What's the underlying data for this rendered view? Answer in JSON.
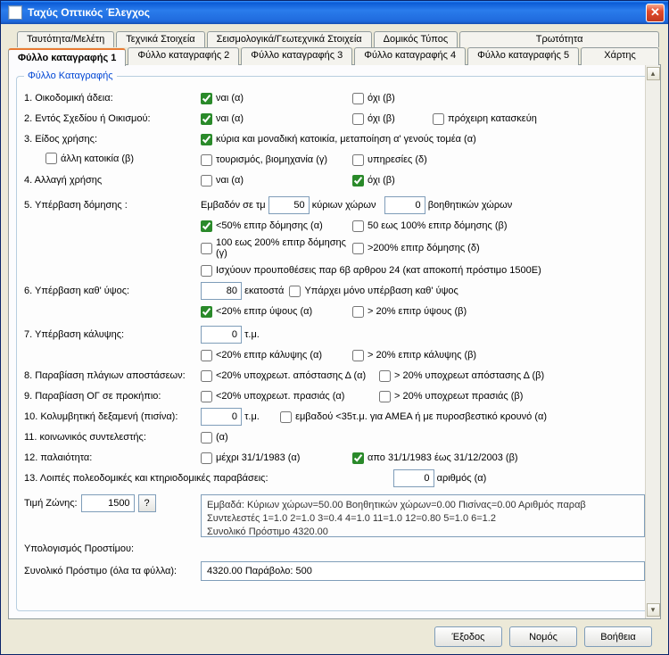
{
  "window": {
    "title": "Ταχύς Οπτικός Έλεγχος"
  },
  "tabs_top": {
    "t0": "Ταυτότητα/Μελέτη",
    "t1": "Τεχνικά Στοιχεία",
    "t2": "Σεισμολογικά/Γεωτεχνικά Στοιχεία",
    "t3": "Δομικός Τύπος",
    "t4": "Τρωτότητα"
  },
  "tabs_sub": {
    "s0": "Φύλλο καταγραφής 1",
    "s1": "Φύλλο καταγραφής 2",
    "s2": "Φύλλο καταγραφής 3",
    "s3": "Φύλλο καταγραφής 4",
    "s4": "Φύλλο καταγραφής 5",
    "s5": "Χάρτης"
  },
  "fs_legend": "Φύλλο Καταγραφής",
  "q1": {
    "label": "1. Οικοδομική άδεια:",
    "a": "ναι (α)",
    "b": "όχι (β)"
  },
  "q2": {
    "label": "2. Εντός Σχεδίου ή Οικισμού:",
    "a": "ναι (α)",
    "b": "όχι (β)",
    "c": "πρόχειρη κατασκεύη"
  },
  "q3": {
    "label": "3. Είδος χρήσης:",
    "a": "κύρια και μοναδική κατοικία, μεταποίηση α' γενούς τομέα  (α)",
    "b": "άλλη κατοικία (β)",
    "c": "τουρισμός, βιομηχανία (γ)",
    "d": "υπηρεσίες  (δ)"
  },
  "q4": {
    "label": "4. Αλλαγή χρήσης",
    "a": "ναι (α)",
    "b": "όχι (β)"
  },
  "q5": {
    "label": "5. Υπέρβαση δόμησης :",
    "pre": "Εμβαδόν σε τμ",
    "mid": "κύριων χώρων",
    "post": "βοηθητικών χώρων",
    "v1": "50",
    "v2": "0",
    "a": "<50% επιτρ δόμησης (α)",
    "b": "50 εως 100% επιτρ δόμησης (β)",
    "c": "100 εως 200% επιτρ δόμησης (γ)",
    "d": ">200% επιτρ δόμησης (δ)",
    "e": "Ισχύουν προυποθέσεις  παρ 6β αρθρου 24 (κατ αποκοπή πρόστιμο 1500Ε)"
  },
  "q6": {
    "label": "6. Υπέρβαση καθ' ύψος:",
    "v": "80",
    "unit": "εκατοστά",
    "only": "Υπάρχει μόνο υπέρβαση καθ' ύψος",
    "a": "<20% επιτρ ύψους (α)",
    "b": "> 20% επιτρ ύψους (β)"
  },
  "q7": {
    "label": "7. Υπέρβαση κάλυψης:",
    "v": "0",
    "unit": "τ.μ.",
    "a": "<20% επιτρ κάλυψης (α)",
    "b": "> 20% επιτρ κάλυψης (β)"
  },
  "q8": {
    "label": "8. Παραβίαση πλάγιων αποστάσεων:",
    "a": "<20% υποχρεωτ. απόστασης Δ  (α)",
    "b": "> 20% υποχρεωτ απόστασης Δ (β)"
  },
  "q9": {
    "label": "9. Παραβίαση ΟΓ σε προκήπιο:",
    "a": "<20% υποχρεωτ. πρασιάς  (α)",
    "b": "> 20% υποχρεωτ πρασιάς  (β)"
  },
  "q10": {
    "label": "10. Κολυμβητική δεξαμενή (πισίνα):",
    "v": "0",
    "unit": "τ.μ.",
    "a": "εμβαδού <35τ.μ. για ΑΜΕΑ ή με πυροσβεστικό κρουνό (α)"
  },
  "q11": {
    "label": "11. κοινωνικός συντελεστής:",
    "a": "(α)"
  },
  "q12": {
    "label": "12. παλαιότητα:",
    "a": "μέχρι 31/1/1983 (α)",
    "b": "απο 31/1/1983 έως 31/12/2003 (β)"
  },
  "q13": {
    "label": "13. Λοιπές πολεοδομικές και κτηριοδομικές παραβάσεις:",
    "v": "0",
    "unit": "αριθμός (α)"
  },
  "zone": {
    "label": "Τιμή Ζώνης:",
    "v": "1500",
    "q": "?"
  },
  "calc": {
    "label_calc": "Υπολογισμός Προστίμου:",
    "line1": "Εμβαδά: Κύριων χώρων=50.00 Βοηθητικών χώρων=0.00 Πισίνας=0.00 Αριθμός παραβ",
    "line2": "Συντελεστές 1=1.0 2=1.0 3=0.4 4=1.0 11=1.0 12=0.80 5=1.0 6=1.2",
    "line3": "Συνολικό Πρόστιμο 4320.00"
  },
  "total": {
    "label": "Συνολικό Πρόστιμο  (όλα τα φύλλα):",
    "value": "4320.00 Παράβολο: 500"
  },
  "footer": {
    "exit": "Έξοδος",
    "law": "Νομός",
    "help": "Βοήθεια"
  }
}
